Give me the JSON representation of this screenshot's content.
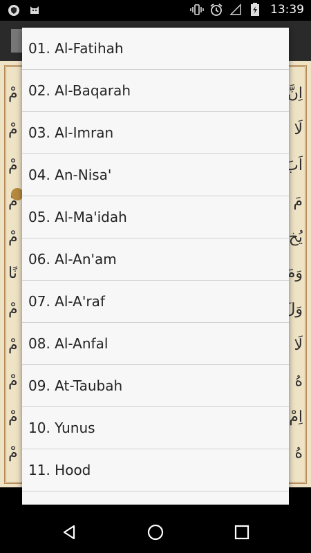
{
  "status_bar": {
    "time": "13:39",
    "icons": [
      "shield-icon",
      "cat-icon",
      "vibrate-icon",
      "alarm-icon",
      "signal-icon",
      "battery-icon"
    ]
  },
  "surah_list": [
    "01. Al-Fatihah",
    "02. Al-Baqarah",
    "03. Al-Imran",
    "04. An-Nisa'",
    "05. Al-Ma'idah",
    "06. Al-An'am",
    "07. Al-A'raf",
    "08. Al-Anfal",
    "09. At-Taubah",
    "10. Yunus",
    "11. Hood",
    ""
  ],
  "navigation": [
    "back-icon",
    "home-icon",
    "recent-apps-icon"
  ],
  "colors": {
    "dialog_bg": "#f7f7f7",
    "divider": "#cfcfcf",
    "page_bg": "#efe3c6",
    "frame": "#b58a57"
  }
}
